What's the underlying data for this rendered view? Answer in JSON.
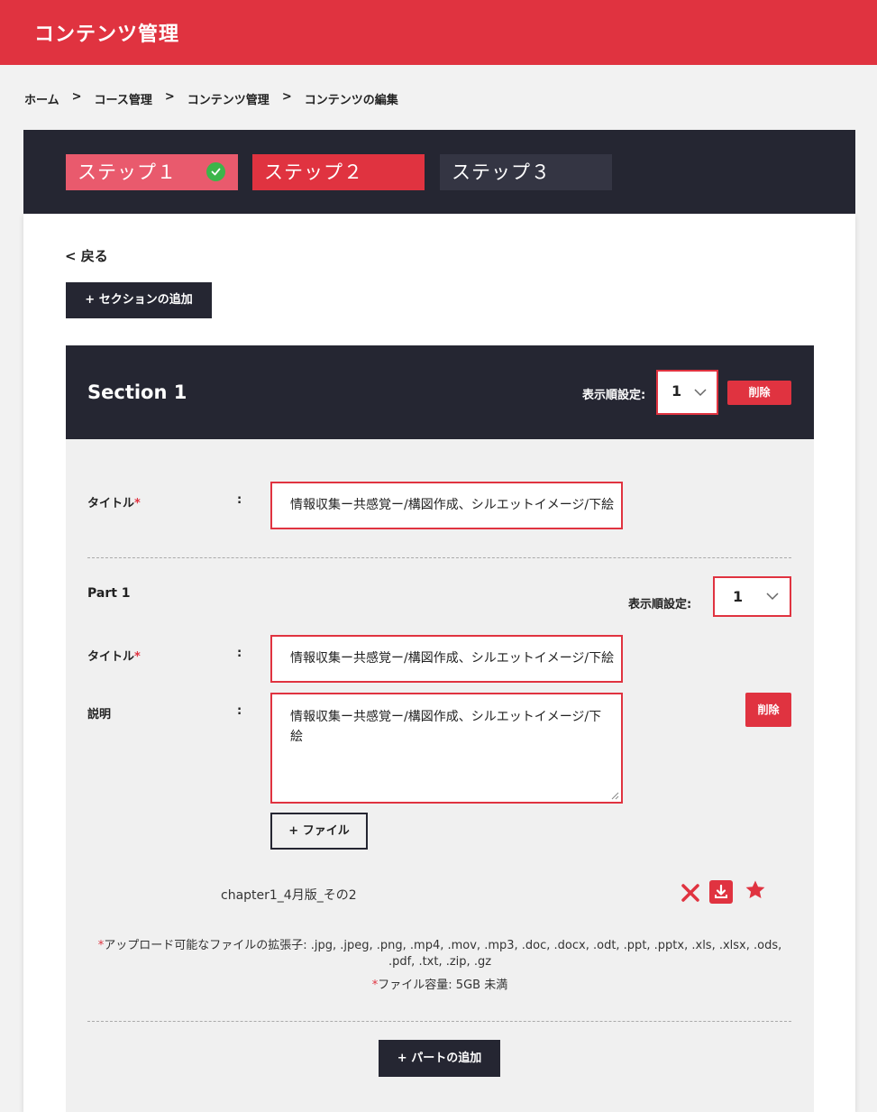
{
  "header": {
    "title": "コンテンツ管理"
  },
  "breadcrumb": {
    "items": [
      "ホーム",
      "コース管理",
      "コンテンツ管理",
      "コンテンツの編集"
    ],
    "separator": ">"
  },
  "steps": [
    {
      "label": "ステップ１",
      "completed": true
    },
    {
      "label": "ステップ２",
      "active": true
    },
    {
      "label": "ステップ３"
    }
  ],
  "back_label": "< 戻る",
  "add_section_label": "+ セクションの追加",
  "section": {
    "title": "Section 1",
    "order_label": "表示順設定:",
    "order_value": "1",
    "delete_label": "削除",
    "title_label": "タイトル",
    "required_mark": "*",
    "colon": ":",
    "title_value": "情報収集ー共感覚ー/構図作成、シルエットイメージ/下絵"
  },
  "part": {
    "title": "Part 1",
    "order_label": "表示順設定:",
    "order_value": "1",
    "title_label": "タイトル",
    "title_value": "情報収集ー共感覚ー/構図作成、シルエットイメージ/下絵",
    "description_label": "説明",
    "description_value": "情報収集ー共感覚ー/構図作成、シルエットイメージ/下絵",
    "delete_label": "削除",
    "add_file_label": "+ ファイル",
    "file_name": "chapter1_4月版_その2",
    "icons": [
      "close-icon",
      "download-icon",
      "star-icon"
    ]
  },
  "notes": {
    "extensions": "アップロード可能なファイルの拡張子: .jpg, .jpeg, .png, .mp4, .mov, .mp3, .doc, .docx, .odt, .ppt, .pptx, .xls, .xlsx, .ods, .pdf, .txt, .zip, .gz",
    "size": "ファイル容量: 5GB 未満"
  },
  "add_part_label": "+ パートの追加",
  "colors": {
    "accent": "#e03340",
    "dark": "#252632",
    "step_done": "#e95a6d",
    "check": "#3cb54a"
  }
}
